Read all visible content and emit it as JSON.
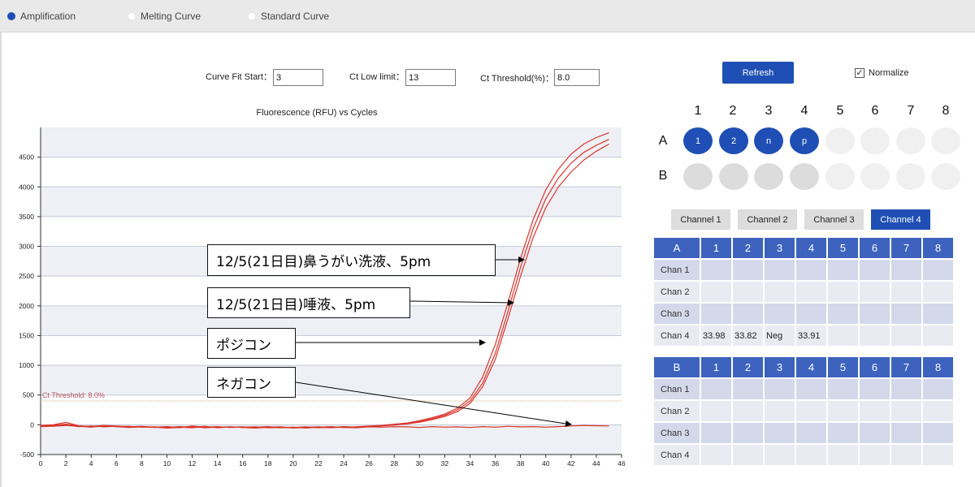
{
  "tabs": [
    {
      "label": "Amplification",
      "selected": true
    },
    {
      "label": "Melting Curve",
      "selected": false
    },
    {
      "label": "Standard Curve",
      "selected": false
    }
  ],
  "params": {
    "curve_fit_start_label": "Curve Fit Start：",
    "curve_fit_start_value": "3",
    "ct_low_limit_label": "Ct Low limit：",
    "ct_low_limit_value": "13",
    "ct_threshold_label": "Ct Threshold(%)：",
    "ct_threshold_value": "8.0"
  },
  "refresh_label": "Refresh",
  "normalize": {
    "label": "Normalize",
    "checked": true
  },
  "chart_data": {
    "type": "line",
    "title": "Fluorescence (RFU) vs Cycles",
    "xlabel": "",
    "ylabel": "",
    "xlim": [
      0,
      46
    ],
    "ylim": [
      -500,
      5000
    ],
    "x_ticks": [
      0,
      2,
      4,
      6,
      8,
      10,
      12,
      14,
      16,
      18,
      20,
      22,
      24,
      26,
      28,
      30,
      32,
      34,
      36,
      38,
      40,
      42,
      44,
      46
    ],
    "y_ticks": [
      -500,
      0,
      500,
      1000,
      1500,
      2000,
      2500,
      3000,
      3500,
      4000,
      4500
    ],
    "threshold": {
      "value": 400,
      "label": "Ct Threshold: 8.0%"
    },
    "line_color": "#d9342b",
    "series": [
      {
        "x": [
          0,
          1,
          2,
          3,
          4,
          5,
          6,
          7,
          8,
          9,
          10,
          11,
          12,
          13,
          14,
          15,
          16,
          17,
          18,
          19,
          20,
          21,
          22,
          23,
          24,
          25,
          26,
          27,
          28,
          29,
          30,
          31,
          32,
          33,
          34,
          35,
          36,
          37,
          38,
          39,
          40,
          41,
          42,
          43,
          44,
          45
        ],
        "y": [
          -10,
          0,
          40,
          -15,
          -30,
          -10,
          -20,
          -35,
          -25,
          -40,
          -30,
          -50,
          -20,
          -40,
          -30,
          -45,
          -40,
          -35,
          -50,
          -45,
          -40,
          -55,
          -40,
          -30,
          -45,
          -35,
          -20,
          -10,
          10,
          30,
          70,
          120,
          180,
          280,
          450,
          800,
          1350,
          2050,
          2800,
          3450,
          3950,
          4300,
          4550,
          4720,
          4830,
          4910
        ]
      },
      {
        "x": [
          0,
          1,
          2,
          3,
          4,
          5,
          6,
          7,
          8,
          9,
          10,
          11,
          12,
          13,
          14,
          15,
          16,
          17,
          18,
          19,
          20,
          21,
          22,
          23,
          24,
          25,
          26,
          27,
          28,
          29,
          30,
          31,
          32,
          33,
          34,
          35,
          36,
          37,
          38,
          39,
          40,
          41,
          42,
          43,
          44,
          45
        ],
        "y": [
          -20,
          -10,
          10,
          -20,
          -25,
          -15,
          -30,
          -25,
          -40,
          -35,
          -45,
          -30,
          -40,
          -25,
          -50,
          -35,
          -45,
          -40,
          -30,
          -45,
          -50,
          -40,
          -35,
          -45,
          -30,
          -40,
          -25,
          -15,
          0,
          20,
          55,
          100,
          160,
          250,
          400,
          700,
          1200,
          1900,
          2650,
          3300,
          3800,
          4150,
          4400,
          4580,
          4700,
          4800
        ]
      },
      {
        "x": [
          0,
          1,
          2,
          3,
          4,
          5,
          6,
          7,
          8,
          9,
          10,
          11,
          12,
          13,
          14,
          15,
          16,
          17,
          18,
          19,
          20,
          21,
          22,
          23,
          24,
          25,
          26,
          27,
          28,
          29,
          30,
          31,
          32,
          33,
          34,
          35,
          36,
          37,
          38,
          39,
          40,
          41,
          42,
          43,
          44,
          45
        ],
        "y": [
          -25,
          -20,
          0,
          -30,
          -20,
          -35,
          -25,
          -40,
          -30,
          -45,
          -35,
          -40,
          -50,
          -30,
          -45,
          -40,
          -35,
          -50,
          -40,
          -35,
          -55,
          -45,
          -40,
          -50,
          -35,
          -40,
          -30,
          -20,
          -5,
          15,
          45,
          85,
          140,
          220,
          360,
          640,
          1100,
          1780,
          2500,
          3150,
          3650,
          4000,
          4250,
          4450,
          4600,
          4720
        ]
      },
      {
        "x": [
          0,
          1,
          2,
          3,
          4,
          5,
          6,
          7,
          8,
          9,
          10,
          11,
          12,
          13,
          14,
          15,
          16,
          17,
          18,
          19,
          20,
          21,
          22,
          23,
          24,
          25,
          26,
          27,
          28,
          29,
          30,
          31,
          32,
          33,
          34,
          35,
          36,
          37,
          38,
          39,
          40,
          41,
          42,
          43,
          44,
          45
        ],
        "y": [
          -30,
          -25,
          -10,
          -25,
          -40,
          -20,
          -30,
          -45,
          -35,
          -40,
          -55,
          -45,
          -30,
          -50,
          -40,
          -35,
          -45,
          -55,
          -40,
          -50,
          -45,
          -35,
          -50,
          -40,
          -45,
          -50,
          -35,
          -40,
          -30,
          -35,
          -45,
          -30,
          -40,
          -35,
          -45,
          -30,
          -40,
          -25,
          -35,
          -30,
          -40,
          -30,
          -20,
          -10,
          -15,
          -20
        ]
      }
    ]
  },
  "annotations": [
    {
      "text": "12/5(21日目)鼻うがい洗液、5pm"
    },
    {
      "text": "12/5(21日目)唾液、5pm"
    },
    {
      "text": "ポジコン"
    },
    {
      "text": "ネガコン"
    }
  ],
  "plate": {
    "columns": [
      "1",
      "2",
      "3",
      "4",
      "5",
      "6",
      "7",
      "8"
    ],
    "rows": [
      "A",
      "B"
    ],
    "row_a_labels": [
      "1",
      "2",
      "n",
      "p"
    ]
  },
  "channels": [
    "Channel 1",
    "Channel 2",
    "Channel 3",
    "Channel 4"
  ],
  "selected_channel": "Channel 4",
  "table_a": {
    "header": "A",
    "columns": [
      "1",
      "2",
      "3",
      "4",
      "5",
      "6",
      "7",
      "8"
    ],
    "rows": [
      {
        "label": "Chan 1",
        "cells": [
          "",
          "",
          "",
          "",
          "",
          "",
          "",
          ""
        ]
      },
      {
        "label": "Chan 2",
        "cells": [
          "",
          "",
          "",
          "",
          "",
          "",
          "",
          ""
        ]
      },
      {
        "label": "Chan 3",
        "cells": [
          "",
          "",
          "",
          "",
          "",
          "",
          "",
          ""
        ]
      },
      {
        "label": "Chan 4",
        "cells": [
          "33.98",
          "33.82",
          "Neg",
          "33.91",
          "",
          "",
          "",
          ""
        ]
      }
    ]
  },
  "table_b": {
    "header": "B",
    "columns": [
      "1",
      "2",
      "3",
      "4",
      "5",
      "6",
      "7",
      "8"
    ],
    "rows": [
      {
        "label": "Chan 1",
        "cells": [
          "",
          "",
          "",
          "",
          "",
          "",
          "",
          ""
        ]
      },
      {
        "label": "Chan 2",
        "cells": [
          "",
          "",
          "",
          "",
          "",
          "",
          "",
          ""
        ]
      },
      {
        "label": "Chan 3",
        "cells": [
          "",
          "",
          "",
          "",
          "",
          "",
          "",
          ""
        ]
      },
      {
        "label": "Chan 4",
        "cells": [
          "",
          "",
          "",
          "",
          "",
          "",
          "",
          ""
        ]
      }
    ]
  },
  "colors": {
    "accent": "#1f4fb4",
    "curve": "#d9342b",
    "threshold": "#b5555d"
  }
}
